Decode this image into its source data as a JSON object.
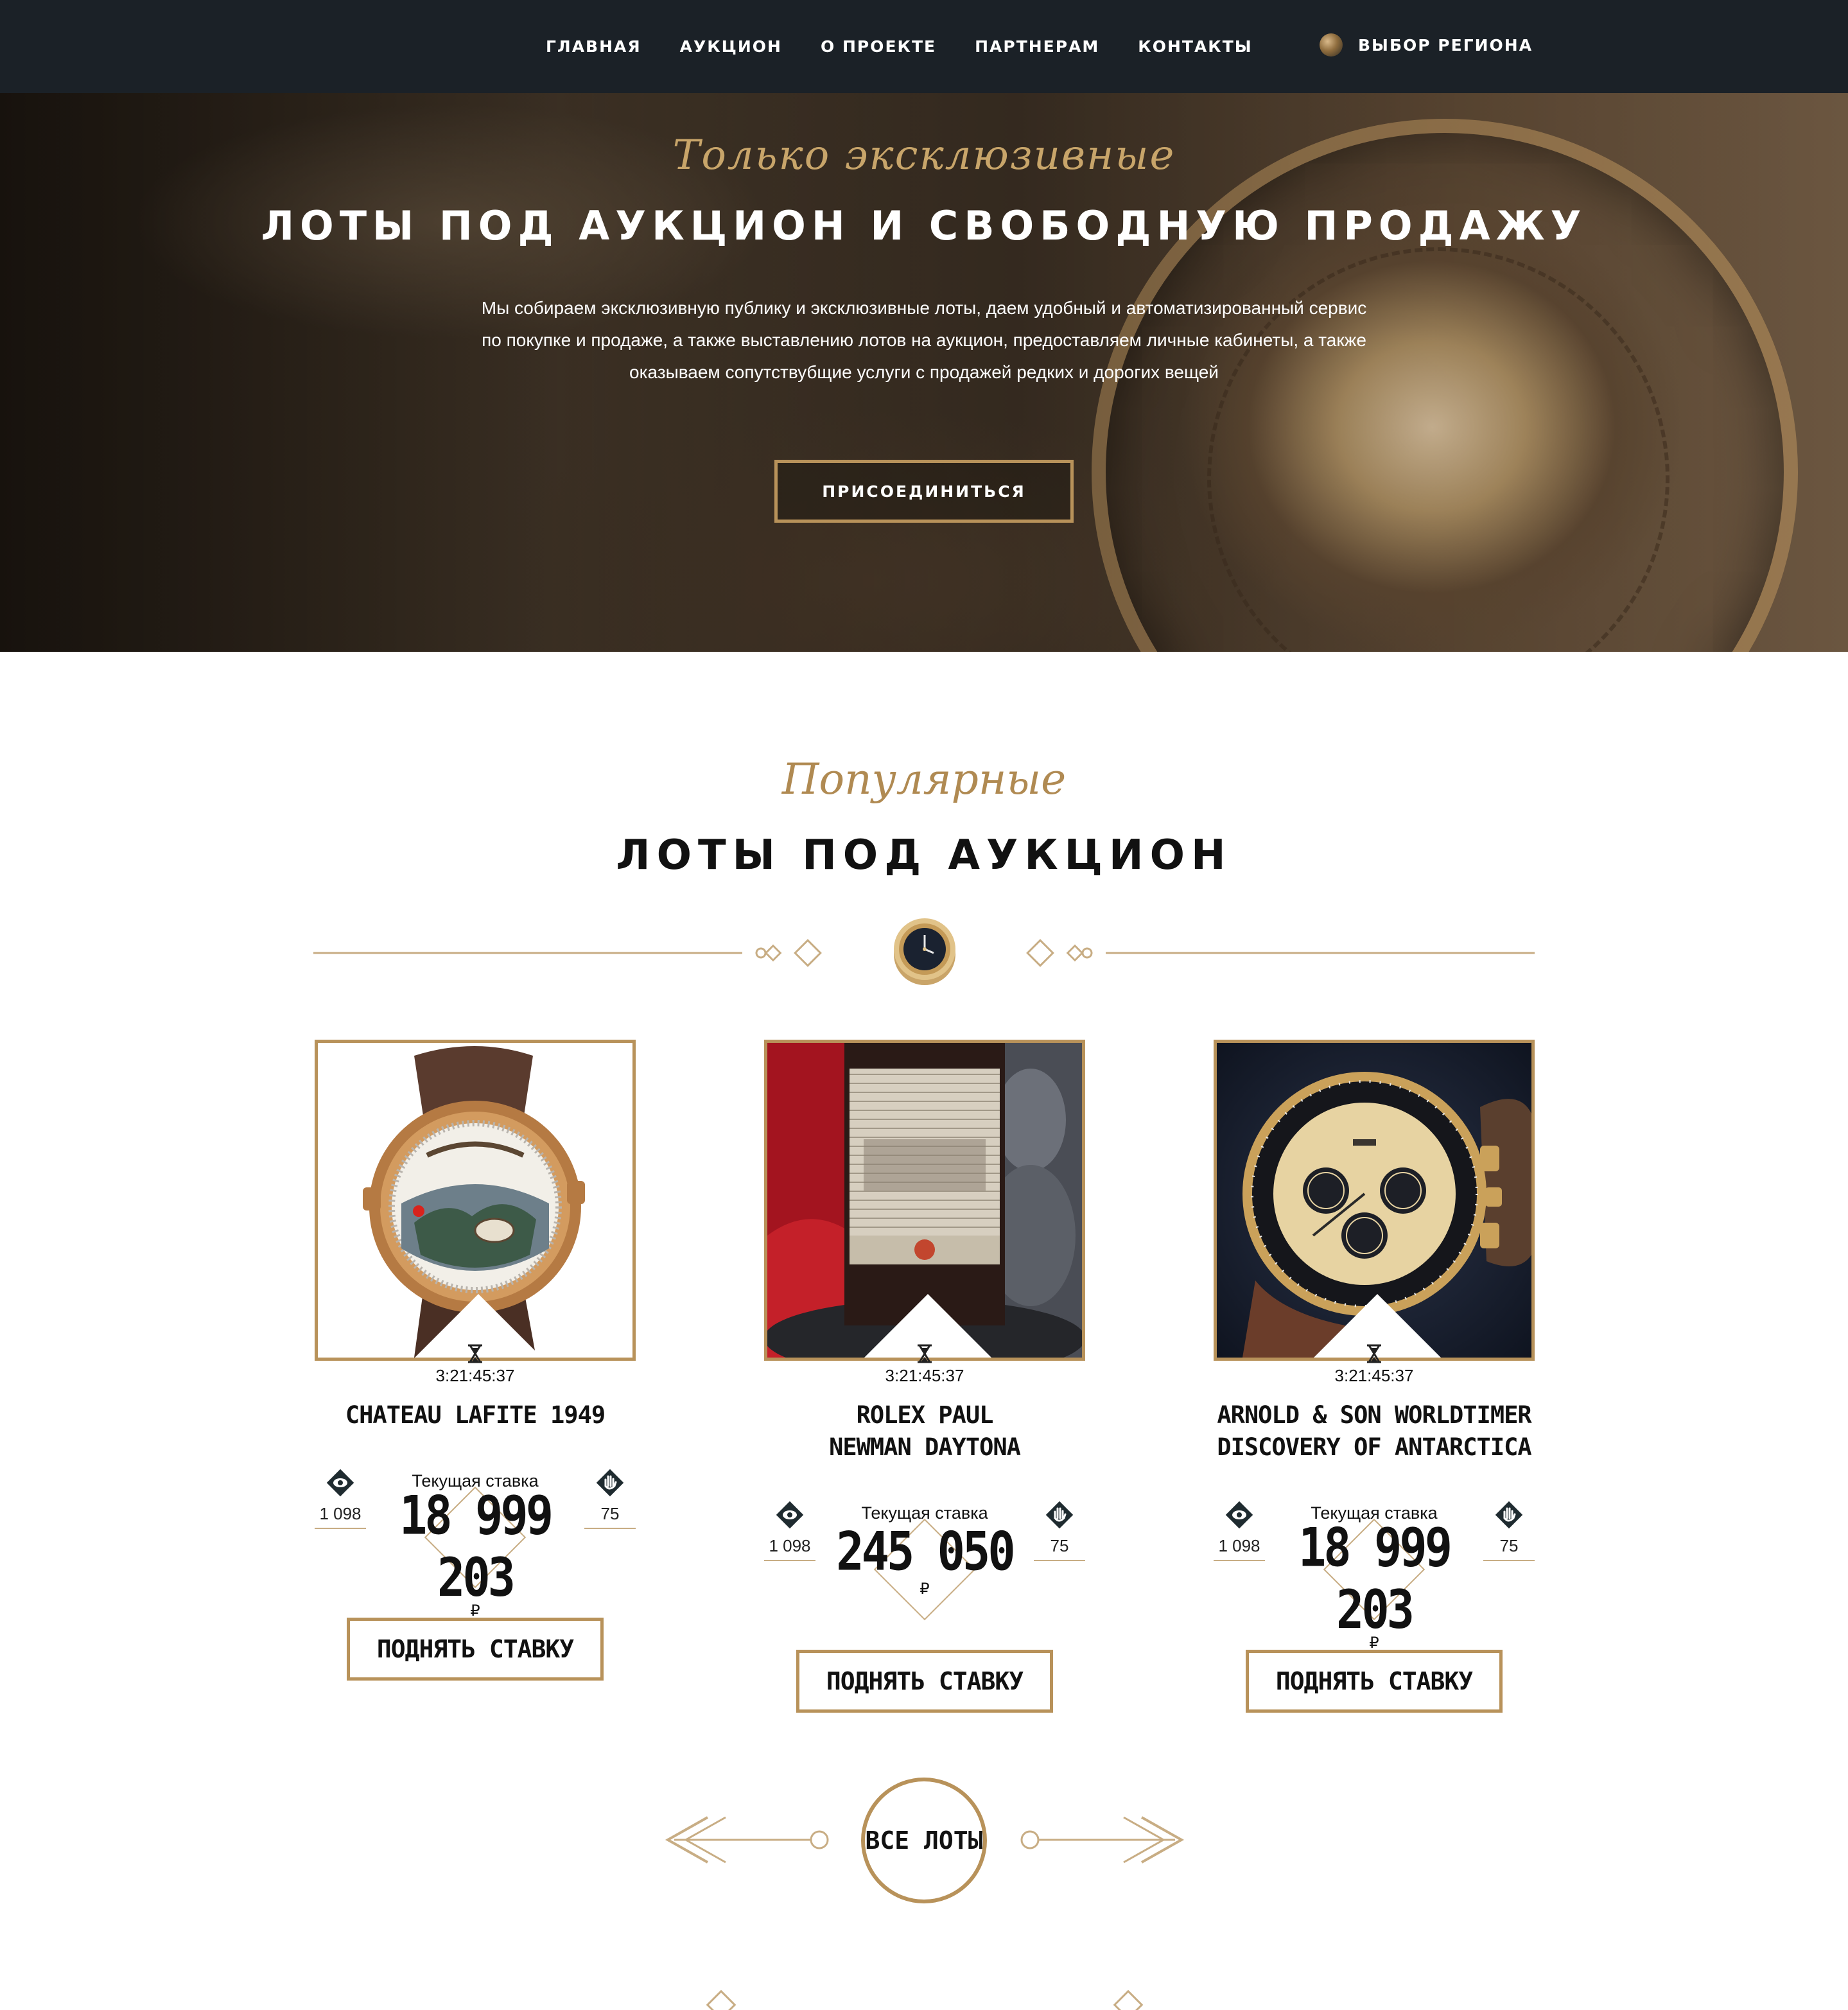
{
  "nav": {
    "items": [
      {
        "label": "ГЛАВНАЯ"
      },
      {
        "label": "АУКЦИОН"
      },
      {
        "label": "О ПРОЕКТЕ"
      },
      {
        "label": "ПАРТНЕРАМ"
      },
      {
        "label": "КОНТАКТЫ"
      }
    ],
    "region_label": "ВЫБОР РЕГИОНА",
    "region_icon": "globe-icon"
  },
  "hero": {
    "script": "Только эксклюзивные",
    "title": "ЛОТЫ ПОД АУКЦИОН И СВОБОДНУЮ ПРОДАЖУ",
    "desc_lines": [
      "Мы собираем эксклюзивную публику и эксклюзивные лоты, даем удобный и автоматизированный сервис",
      "по покупке и продаже, а также выставлению лотов на аукцион, предоставляем личные кабинеты, а также",
      "оказываем сопутствубщие услуги с продажей редких и дорогих вещей"
    ],
    "join_button": "ПРИСОЕДИНИТЬСЯ"
  },
  "section": {
    "script": "Популярные",
    "title": "ЛОТЫ ПОД АУКЦИОН"
  },
  "lots": [
    {
      "image": "watch-arnold-son-image",
      "timer": "3:21:45:37",
      "title": "CHATEAU LAFITE 1949",
      "views": "1 098",
      "bids": "75",
      "bid_label": "Текущая ставка",
      "bid_amount": "18 999 203",
      "currency": "₽",
      "button": "ПОДНЯТЬ СТАВКУ"
    },
    {
      "image": "wine-bottle-image",
      "timer": "3:21:45:37",
      "title": "ROLEX PAUL NEWMAN DAYTONA",
      "views": "1 098",
      "bids": "75",
      "bid_label": "Текущая ставка",
      "bid_amount": "245 050",
      "currency": "₽",
      "button": "ПОДНЯТЬ СТАВКУ"
    },
    {
      "image": "watch-rolex-daytona-image",
      "timer": "3:21:45:37",
      "title": "ARNOLD & SON WORLDTIMER DISCOVERY OF ANTARCTICA",
      "views": "1 098",
      "bids": "75",
      "bid_label": "Текущая ставка",
      "bid_amount": "18 999 203",
      "currency": "₽",
      "button": "ПОДНЯТЬ СТАВКУ"
    }
  ],
  "all_lots_button": "ВСЕ ЛОТЫ",
  "colors": {
    "nav_bg": "#1b2127",
    "gold": "#b8925a",
    "text": "#111111"
  }
}
